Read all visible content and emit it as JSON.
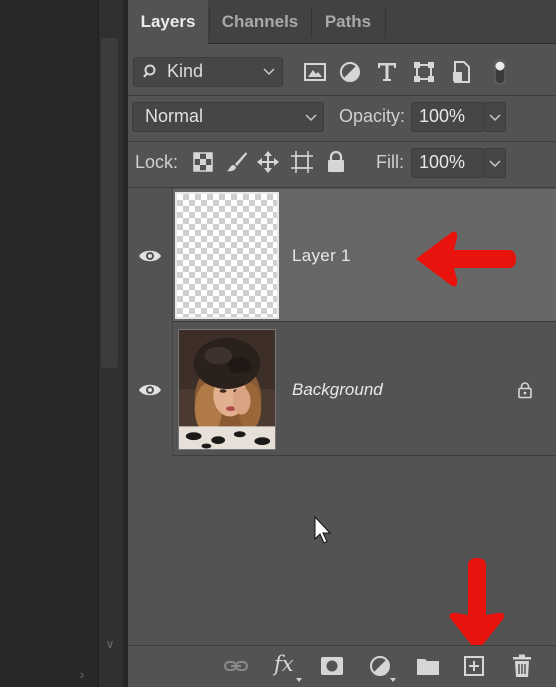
{
  "tabs": [
    {
      "label": "Layers",
      "active": true
    },
    {
      "label": "Channels",
      "active": false
    },
    {
      "label": "Paths",
      "active": false
    }
  ],
  "filter": {
    "kind_label": "Kind",
    "icons": [
      "pixel-filter-icon",
      "adjustment-filter-icon",
      "type-filter-icon",
      "shape-filter-icon",
      "smart-object-filter-icon",
      "filter-toggle-icon"
    ]
  },
  "blend": {
    "mode": "Normal",
    "opacity_label": "Opacity:",
    "opacity_value": "100%"
  },
  "lock": {
    "label": "Lock:",
    "icons": [
      "lock-transparent-pixels-icon",
      "lock-image-pixels-icon",
      "lock-position-icon",
      "lock-artboard-icon",
      "lock-all-icon"
    ],
    "fill_label": "Fill:",
    "fill_value": "100%"
  },
  "layers": [
    {
      "name": "Layer 1",
      "selected": true,
      "visible": true,
      "thumbnail": "transparent-checkerboard",
      "locked": false
    },
    {
      "name": "Background",
      "selected": false,
      "visible": true,
      "thumbnail": "photo-woman-in-fur-hat",
      "locked": true
    }
  ],
  "bottom_bar": {
    "icons": [
      "link-layers-icon",
      "fx-icon",
      "add-mask-icon",
      "adjustment-layer-icon",
      "new-group-icon",
      "new-layer-icon",
      "delete-layer-icon"
    ],
    "fx_label": "fx"
  },
  "annotations": {
    "arrow_color": "#e8130d"
  },
  "colors": {
    "panel_bg": "#535353",
    "selected_row": "#676767",
    "tabbar_bg": "#424242",
    "canvas_bg": "#282828"
  }
}
